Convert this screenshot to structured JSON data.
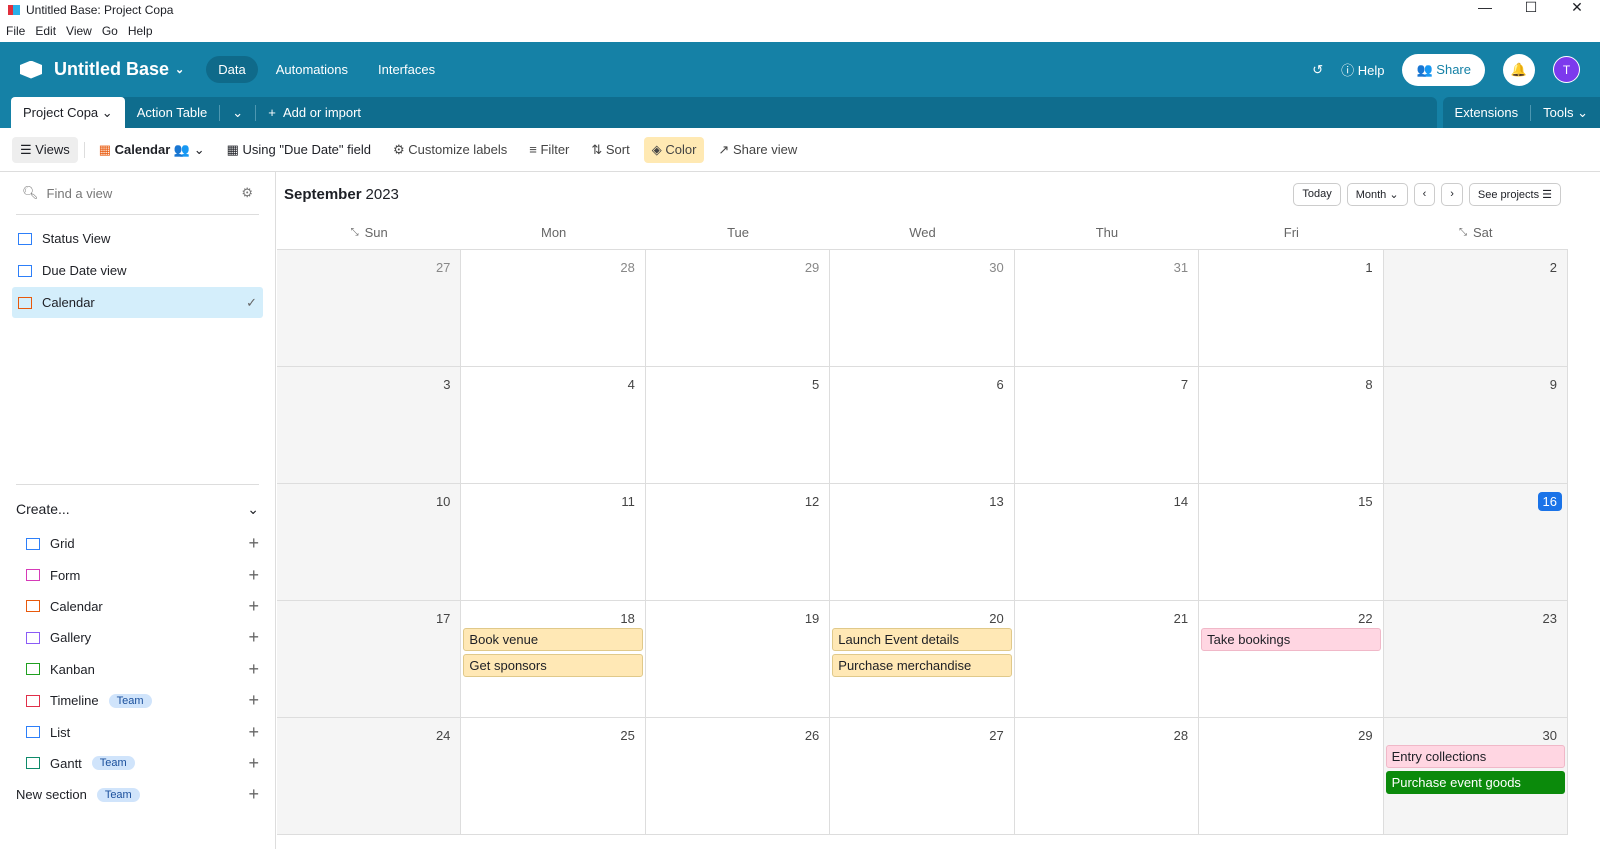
{
  "window": {
    "title": "Untitled Base: Project Copa",
    "menu": [
      "File",
      "Edit",
      "View",
      "Go",
      "Help"
    ]
  },
  "header": {
    "base_name": "Untitled Base",
    "nav": [
      "Data",
      "Automations",
      "Interfaces"
    ],
    "help": "Help",
    "share": "Share",
    "avatar": "T"
  },
  "tabs": {
    "active": "Project Copa",
    "other": "Action Table",
    "add": "Add or import",
    "extensions": "Extensions",
    "tools": "Tools"
  },
  "toolbar": {
    "views": "Views",
    "view_name": "Calendar",
    "using": "Using \"Due Date\" field",
    "customize": "Customize labels",
    "filter": "Filter",
    "sort": "Sort",
    "color": "Color",
    "share_view": "Share view"
  },
  "sidebar": {
    "find_placeholder": "Find a view",
    "views": [
      "Status View",
      "Due Date view",
      "Calendar"
    ],
    "create": "Create...",
    "create_items": [
      {
        "label": "Grid",
        "color": "#2d7ff9"
      },
      {
        "label": "Form",
        "color": "#d63ab8"
      },
      {
        "label": "Calendar",
        "color": "#e8590c"
      },
      {
        "label": "Gallery",
        "color": "#8b5cf6"
      },
      {
        "label": "Kanban",
        "color": "#20a020"
      },
      {
        "label": "Timeline",
        "color": "#e0304a",
        "badge": "Team"
      },
      {
        "label": "List",
        "color": "#2d7ff9"
      },
      {
        "label": "Gantt",
        "color": "#0f8a6a",
        "badge": "Team"
      },
      {
        "label": "New section",
        "badge": "Team"
      }
    ]
  },
  "calendar": {
    "month": "September",
    "year": "2023",
    "today": "Today",
    "mode": "Month",
    "see_projects": "See projects",
    "days": [
      "Sun",
      "Mon",
      "Tue",
      "Wed",
      "Thu",
      "Fri",
      "Sat"
    ],
    "weeks": [
      [
        {
          "d": "27"
        },
        {
          "d": "28"
        },
        {
          "d": "29"
        },
        {
          "d": "30"
        },
        {
          "d": "31"
        },
        {
          "d": "1"
        },
        {
          "d": "2"
        }
      ],
      [
        {
          "d": "3"
        },
        {
          "d": "4"
        },
        {
          "d": "5"
        },
        {
          "d": "6"
        },
        {
          "d": "7"
        },
        {
          "d": "8"
        },
        {
          "d": "9"
        }
      ],
      [
        {
          "d": "10"
        },
        {
          "d": "11"
        },
        {
          "d": "12"
        },
        {
          "d": "13"
        },
        {
          "d": "14"
        },
        {
          "d": "15"
        },
        {
          "d": "16",
          "today": true
        }
      ],
      [
        {
          "d": "17"
        },
        {
          "d": "18",
          "events": [
            {
              "t": "Book venue",
              "c": "#ffe8b5"
            },
            {
              "t": "Get sponsors",
              "c": "#ffe8b5"
            }
          ]
        },
        {
          "d": "19"
        },
        {
          "d": "20",
          "events": [
            {
              "t": "Launch Event details",
              "c": "#ffe8b5"
            },
            {
              "t": "Purchase merchandise",
              "c": "#ffe8b5"
            }
          ]
        },
        {
          "d": "21"
        },
        {
          "d": "22",
          "events": [
            {
              "t": "Take bookings",
              "c": "#ffd6e2"
            }
          ]
        },
        {
          "d": "23"
        }
      ],
      [
        {
          "d": "24"
        },
        {
          "d": "25"
        },
        {
          "d": "26"
        },
        {
          "d": "27"
        },
        {
          "d": "28"
        },
        {
          "d": "29"
        },
        {
          "d": "30",
          "events": [
            {
              "t": "Entry collections",
              "c": "#ffd6e2"
            },
            {
              "t": "Purchase event goods",
              "c": "#0b8a0b",
              "fg": "#fff"
            }
          ]
        }
      ]
    ]
  }
}
